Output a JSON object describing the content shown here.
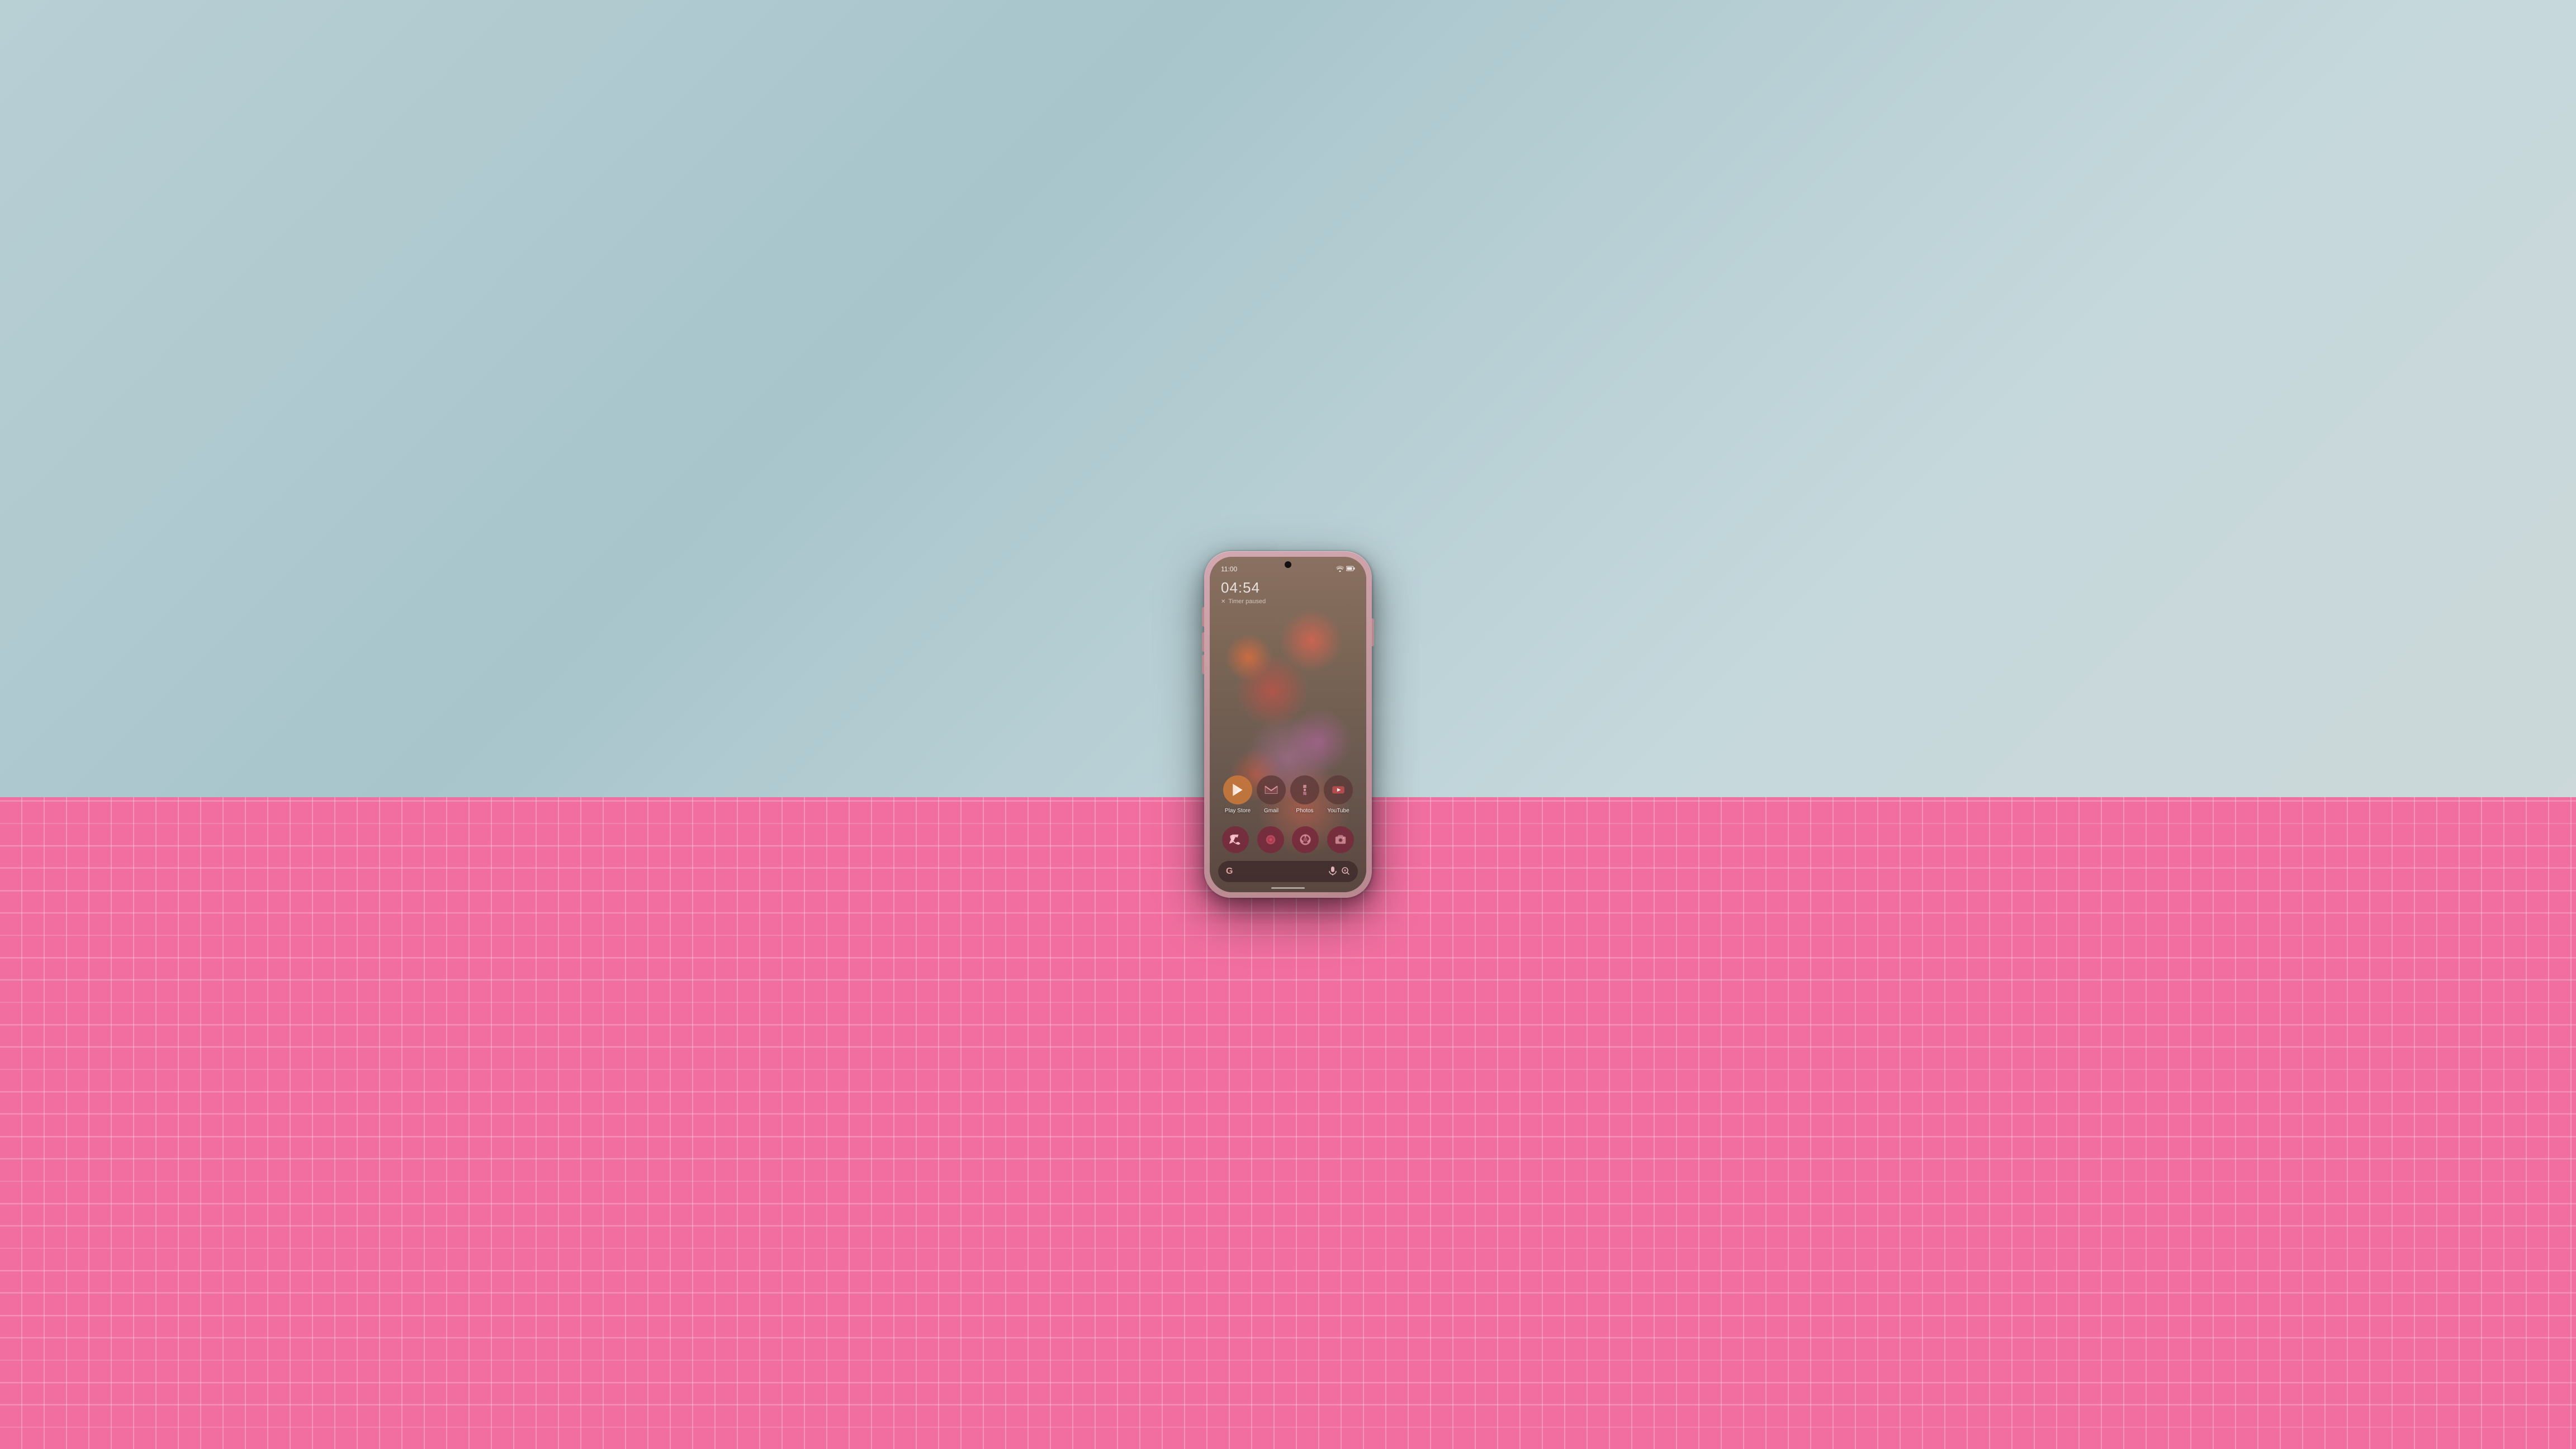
{
  "background": {
    "desk_color": "#f06fa0"
  },
  "status_bar": {
    "time": "11:00",
    "wifi": "▾",
    "battery": "▮"
  },
  "notification": {
    "timer": "04:54",
    "timer_status": "Timer paused",
    "timer_icon": "✕"
  },
  "apps": [
    {
      "id": "play-store",
      "label": "Play Store",
      "highlighted": true
    },
    {
      "id": "gmail",
      "label": "Gmail",
      "highlighted": false
    },
    {
      "id": "photos",
      "label": "Photos",
      "highlighted": false
    },
    {
      "id": "youtube",
      "label": "YouTube",
      "highlighted": false
    }
  ],
  "dock": [
    {
      "id": "phone",
      "label": "Phone"
    },
    {
      "id": "messages",
      "label": "Messages"
    },
    {
      "id": "chrome",
      "label": "Chrome"
    },
    {
      "id": "camera",
      "label": "Camera"
    }
  ],
  "search_bar": {
    "g_logo": "G",
    "mic_label": "mic",
    "lens_label": "lens"
  }
}
